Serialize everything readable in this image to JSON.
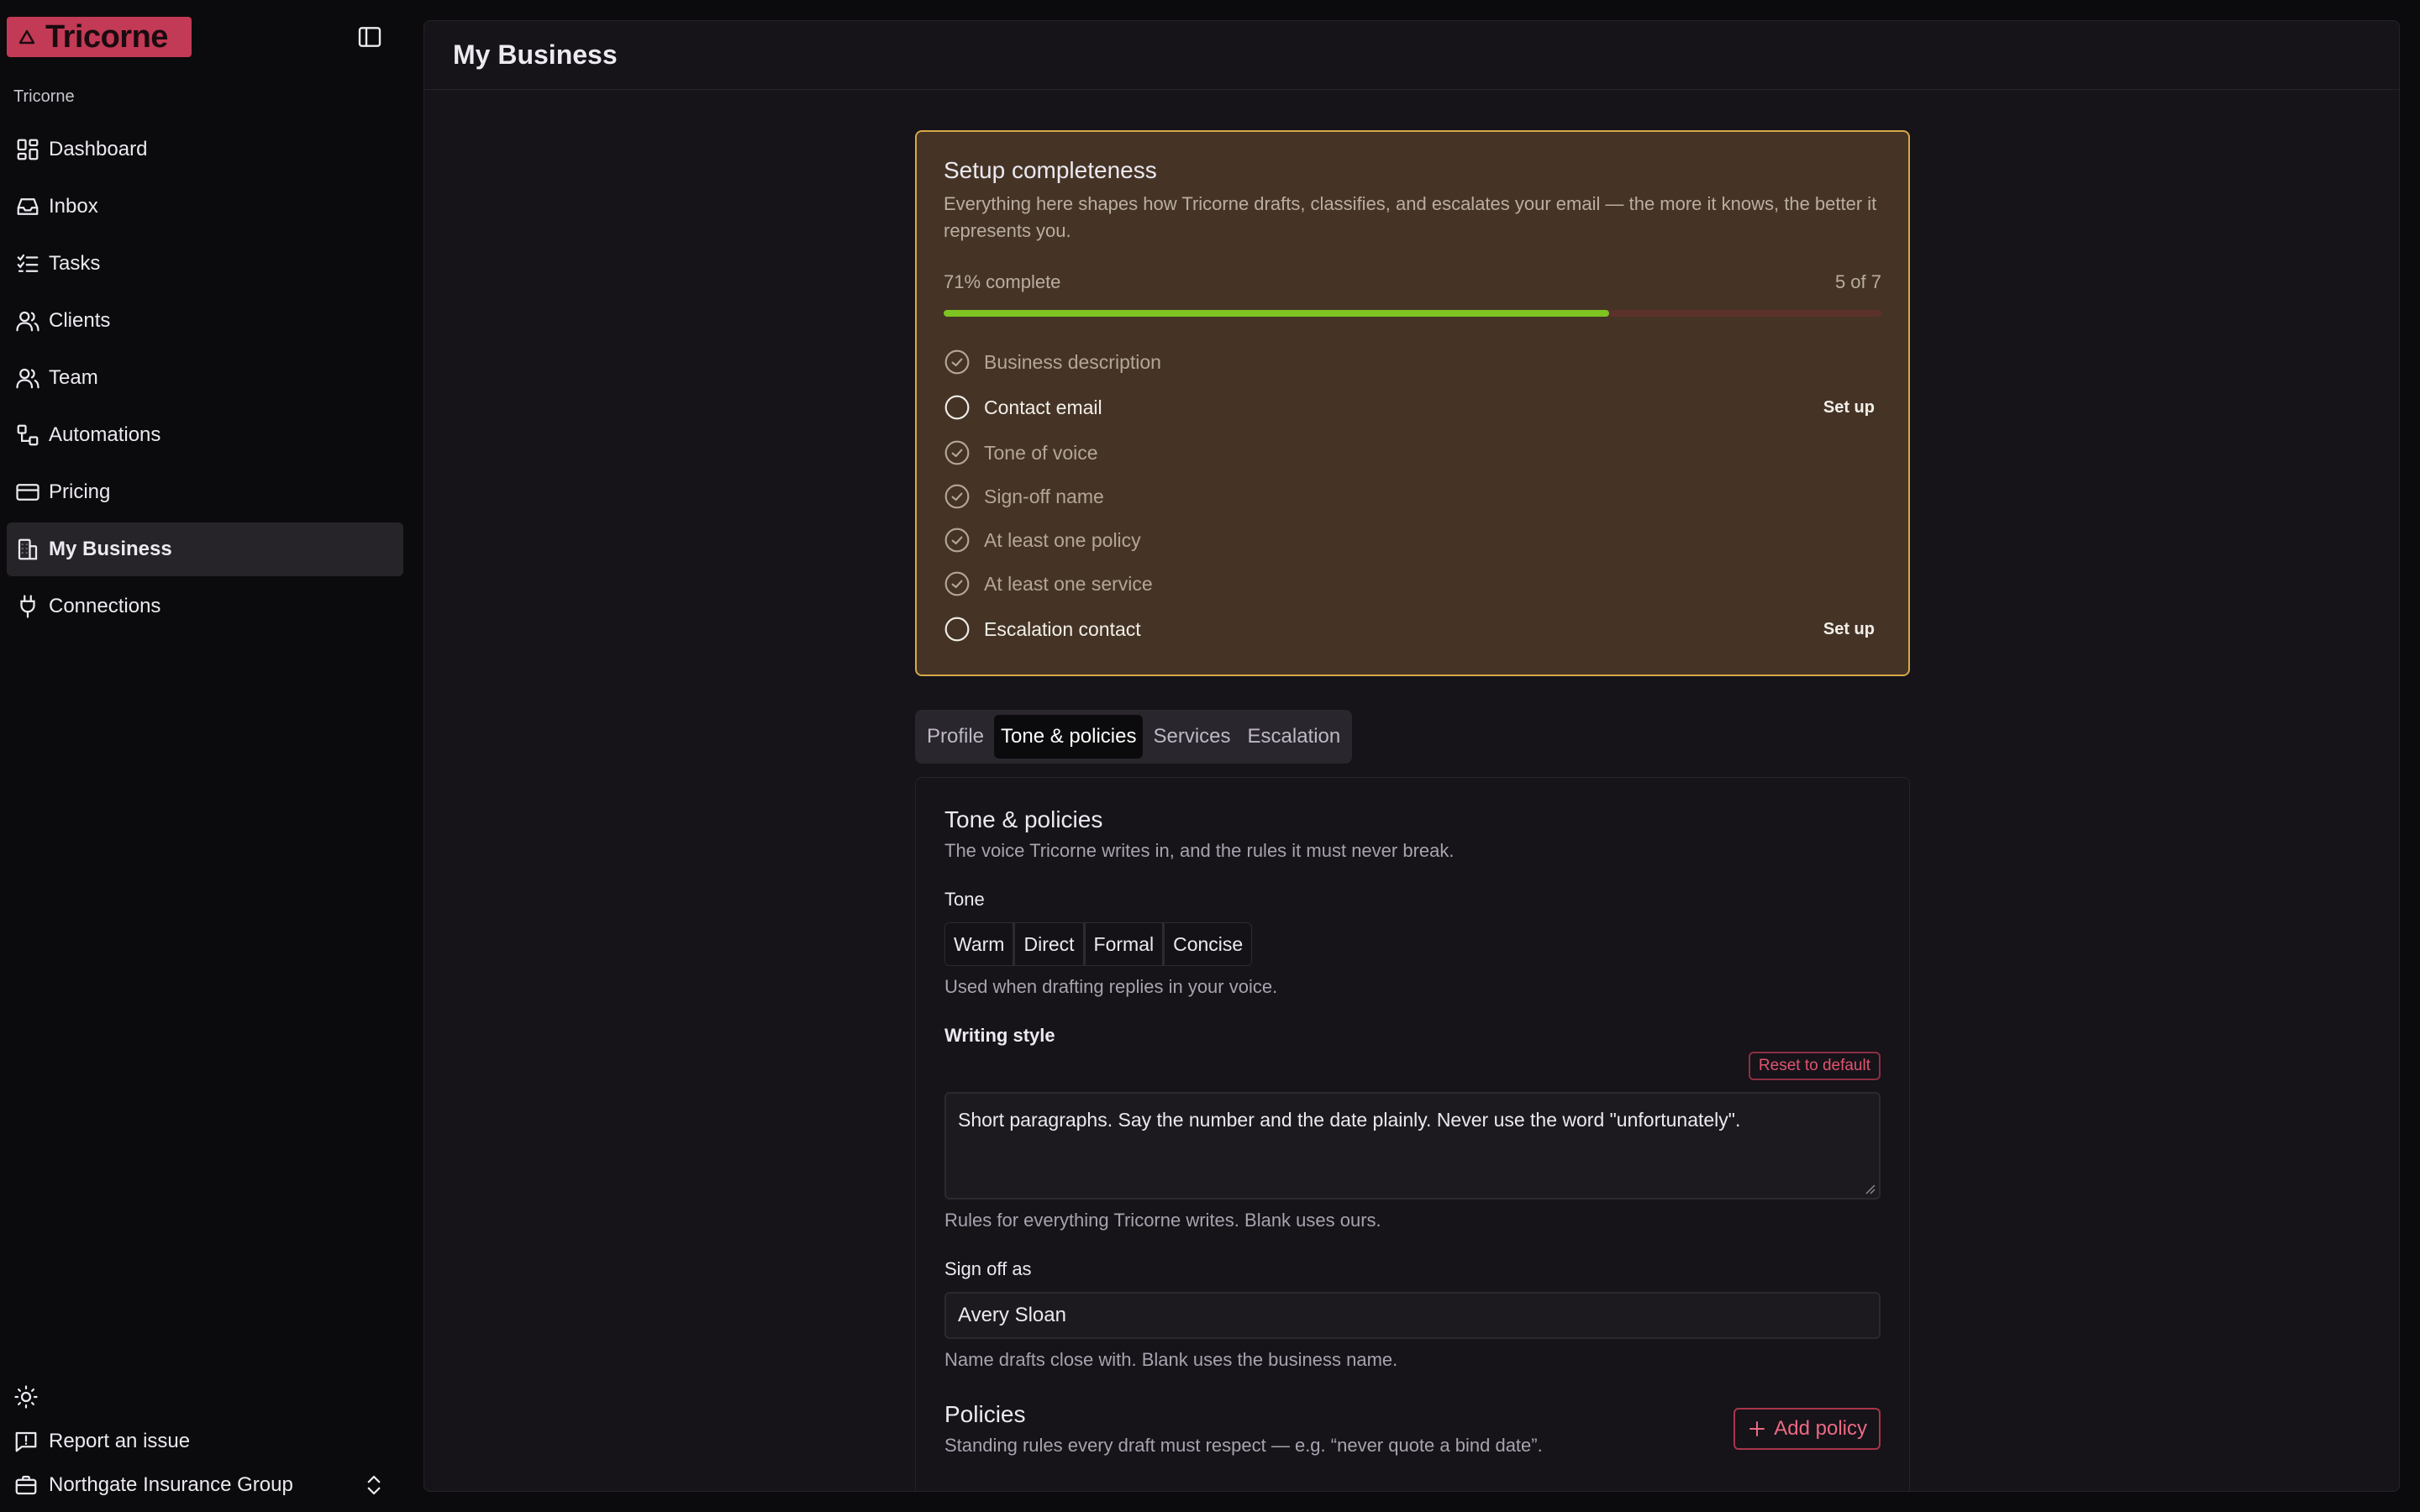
{
  "app": {
    "logo_text": "Tricorne",
    "org_label": "Tricorne"
  },
  "sidebar": {
    "items": [
      {
        "label": "Dashboard",
        "icon": "dashboard-icon"
      },
      {
        "label": "Inbox",
        "icon": "inbox-icon"
      },
      {
        "label": "Tasks",
        "icon": "tasks-icon"
      },
      {
        "label": "Clients",
        "icon": "clients-icon"
      },
      {
        "label": "Team",
        "icon": "team-icon"
      },
      {
        "label": "Automations",
        "icon": "automations-icon"
      },
      {
        "label": "Pricing",
        "icon": "pricing-icon"
      },
      {
        "label": "My Business",
        "icon": "building-icon",
        "active": true
      },
      {
        "label": "Connections",
        "icon": "plug-icon"
      }
    ],
    "report_label": "Report an issue",
    "workspace_name": "Northgate Insurance Group"
  },
  "page": {
    "title": "My Business"
  },
  "setup": {
    "title": "Setup completeness",
    "description": "Everything here shapes how Tricorne drafts, classifies, and escalates your email — the more it knows, the better it represents you.",
    "progress_label": "71% complete",
    "progress_count": "5 of 7",
    "progress_fraction": 0.71,
    "setup_link_label": "Set up",
    "items": [
      {
        "label": "Business description",
        "done": true
      },
      {
        "label": "Contact email",
        "done": false
      },
      {
        "label": "Tone of voice",
        "done": true
      },
      {
        "label": "Sign-off name",
        "done": true
      },
      {
        "label": "At least one policy",
        "done": true
      },
      {
        "label": "At least one service",
        "done": true
      },
      {
        "label": "Escalation contact",
        "done": false
      }
    ]
  },
  "tabs": [
    {
      "label": "Profile"
    },
    {
      "label": "Tone & policies",
      "active": true
    },
    {
      "label": "Services"
    },
    {
      "label": "Escalation"
    }
  ],
  "tone_section": {
    "title": "Tone & policies",
    "description": "The voice Tricorne writes in, and the rules it must never break.",
    "tone_label": "Tone",
    "tone_options": [
      "Warm",
      "Direct",
      "Formal",
      "Concise"
    ],
    "tone_help": "Used when drafting replies in your voice.",
    "writing_style_label": "Writing style",
    "reset_label": "Reset to default",
    "writing_style_value": "Short paragraphs. Say the number and the date plainly. Never use the word \"unfortunately\".",
    "writing_style_help": "Rules for everything Tricorne writes. Blank uses ours.",
    "signoff_label": "Sign off as",
    "signoff_value": "Avery Sloan",
    "signoff_help": "Name drafts close with. Blank uses the business name.",
    "policies_title": "Policies",
    "policies_desc": "Standing rules every draft must respect — e.g. “never quote a bind date”.",
    "add_policy_label": "Add policy"
  },
  "colors": {
    "accent": "#c23a55",
    "setup_border": "#d6a848",
    "progress_fill": "#7ec522",
    "progress_track": "#5b3129"
  }
}
